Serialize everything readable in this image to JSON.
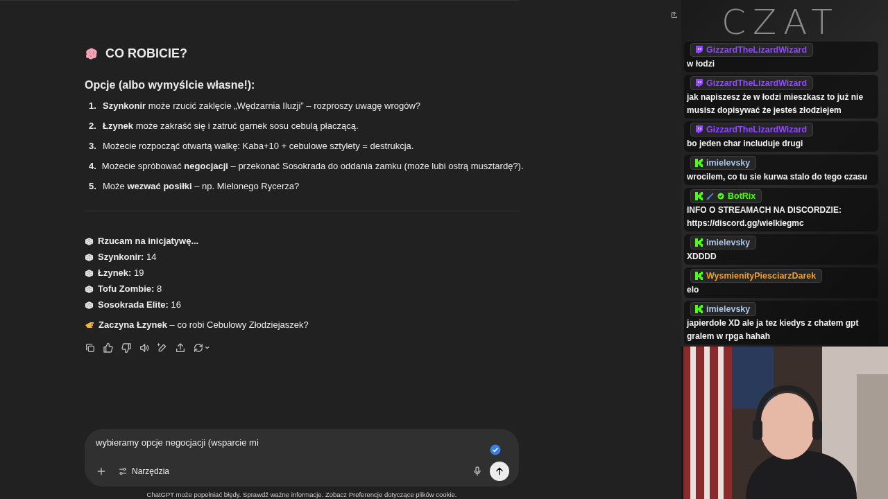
{
  "conversation": {
    "heading": "CO ROBICIE?",
    "subheading": "Opcje (albo wymyślcie własne!):",
    "options": [
      {
        "number": "1.",
        "text": "**Szynkonir** może rzucić zaklęcie „Wędzarnia Iluzji” – rozproszy uwagę wrogów?"
      },
      {
        "number": "2.",
        "text": "**Łzynek** może zakraść się i zatruć garnek sosu cebulą płaczącą."
      },
      {
        "number": "3.",
        "text": "Możecie rozpocząć otwartą walkę: Kaba+10 + cebulowe sztylety = destrukcja."
      },
      {
        "number": "4.",
        "text": "Możecie spróbować **negocjacji** – przekonać Sosokrada do oddania zamku (może lubi ostrą musztardę?)."
      },
      {
        "number": "5.",
        "text": "Może **wezwać posiłki** – np. Mielonego Rycerza?"
      }
    ],
    "rolls": [
      "**Rzucam na inicjatywę...**",
      "**Szynkonir:** 14",
      "**Łzynek:** 19",
      "**Tofu Zombie:** 8",
      "**Sosokrada Elite:** 16"
    ],
    "next_turn": "**Zaczyna Łzynek** – co robi Cebulowy Złodziejaszek?"
  },
  "composer": {
    "value": "wybieramy opcje negocjacji (wsparcie mi",
    "tools_label": "Narzędzia"
  },
  "disclaimer": "ChatGPT może popełniać błędy. Sprawdź ważne informacje. Zobacz Preferencje dotyczące plików cookie.",
  "stream_chat": {
    "title": "CZAT",
    "messages": [
      {
        "kind": "twitch",
        "user": "GizzardTheLizardWizard",
        "color": "#9147ff",
        "text": "w łodzi"
      },
      {
        "kind": "twitch",
        "user": "GizzardTheLizardWizard",
        "color": "#9147ff",
        "text": "jak napiszesz że w łodzi mieszkasz to już nie musisz dopisywać że jesteś złodziejem"
      },
      {
        "kind": "twitch",
        "user": "GizzardTheLizardWizard",
        "color": "#9147ff",
        "text": "bo jeden char includuje drugi"
      },
      {
        "kind": "kick",
        "user": "imielevsky",
        "color": "#a9c4e6",
        "text": "wrocilem, co tu sie kurwa stalo do tego czasu"
      },
      {
        "kind": "kick",
        "user": "BotRix",
        "color": "#53fc18",
        "badges": [
          {
            "kind": "sword"
          },
          {
            "kind": "verified"
          }
        ],
        "text": "INFO O STREAMACH NA DISCORDZIE: https://discord.gg/wielkiegmc"
      },
      {
        "kind": "kick",
        "user": "imielevsky",
        "color": "#a9c4e6",
        "text": "XDDDD"
      },
      {
        "kind": "kick",
        "user": "WysmienityPiesciarzDarek",
        "color": "#f0a020",
        "text": "elo"
      },
      {
        "kind": "kick",
        "user": "imielevsky",
        "color": "#a9c4e6",
        "text": "japierdole XD ale ja tez kiedys z chatem gpt gralem w rpga hahah"
      }
    ]
  }
}
